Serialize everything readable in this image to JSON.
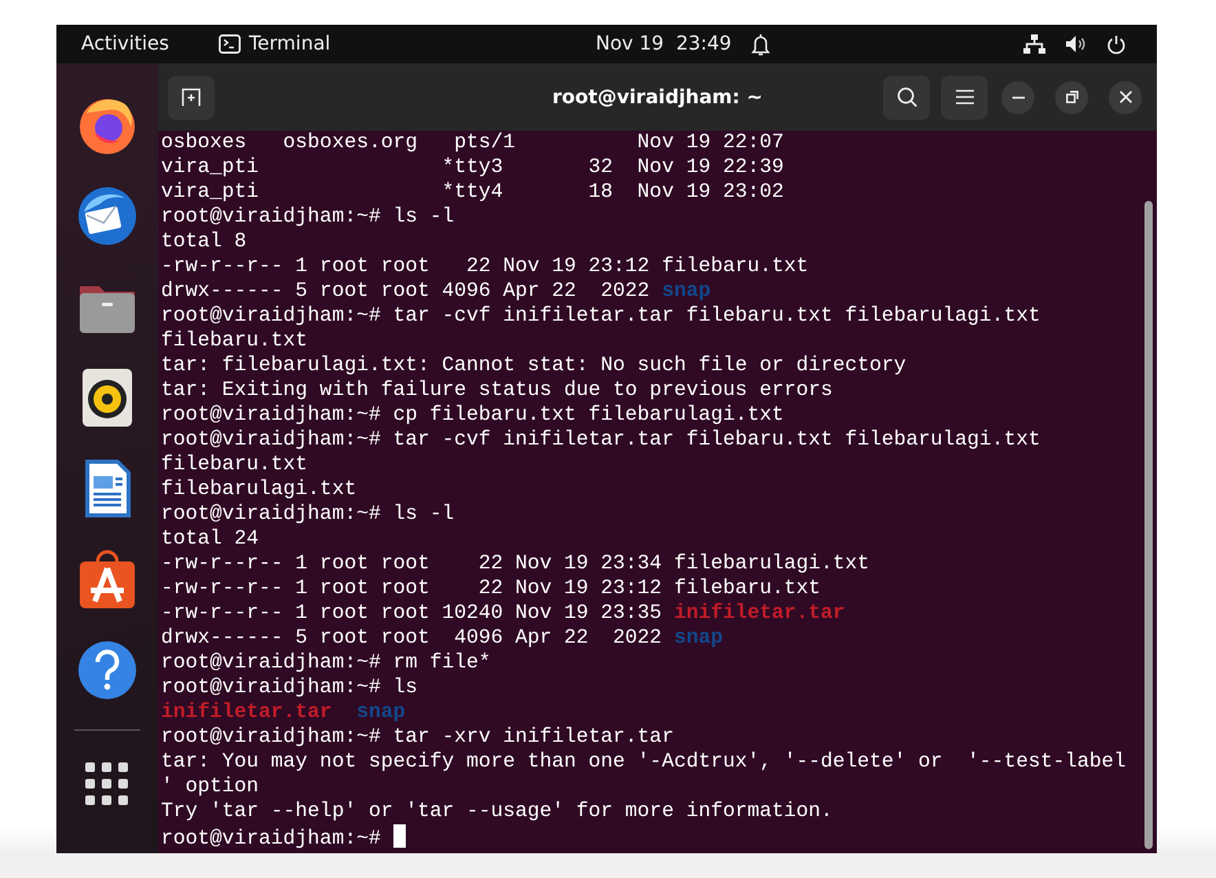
{
  "top_bar": {
    "activities": "Activities",
    "app_name": "Terminal",
    "clock": "Nov 19  23:49"
  },
  "dock": {
    "items": [
      {
        "kind": "browser"
      },
      {
        "kind": "mail"
      },
      {
        "kind": "files"
      },
      {
        "kind": "music"
      },
      {
        "kind": "writer"
      },
      {
        "kind": "software"
      },
      {
        "kind": "help"
      }
    ]
  },
  "terminal": {
    "title": "root@viraidjham: ~",
    "cursor": true,
    "lines": [
      [
        {
          "kind": "text",
          "text": "osboxes   osboxes.org   pts/1          Nov 19 22:07"
        }
      ],
      [
        {
          "kind": "text",
          "text": "vira_pti               *tty3       32  Nov 19 22:39"
        }
      ],
      [
        {
          "kind": "text",
          "text": "vira_pti               *tty4       18  Nov 19 23:02"
        }
      ],
      [
        {
          "kind": "text",
          "text": "root@viraidjham:~# ls -l"
        }
      ],
      [
        {
          "kind": "text",
          "text": "total 8"
        }
      ],
      [
        {
          "kind": "text",
          "text": "-rw-r--r-- 1 root root   22 Nov 19 23:12 filebaru.txt"
        }
      ],
      [
        {
          "kind": "text",
          "text": "drwx------ 5 root root 4096 Apr 22  2022 "
        },
        {
          "kind": "directory",
          "text": "snap"
        }
      ],
      [
        {
          "kind": "text",
          "text": "root@viraidjham:~# tar -cvf inifiletar.tar filebaru.txt filebarulagi.txt"
        }
      ],
      [
        {
          "kind": "text",
          "text": "filebaru.txt"
        }
      ],
      [
        {
          "kind": "text",
          "text": "tar: filebarulagi.txt: Cannot stat: No such file or directory"
        }
      ],
      [
        {
          "kind": "text",
          "text": "tar: Exiting with failure status due to previous errors"
        }
      ],
      [
        {
          "kind": "text",
          "text": "root@viraidjham:~# cp filebaru.txt filebarulagi.txt"
        }
      ],
      [
        {
          "kind": "text",
          "text": "root@viraidjham:~# tar -cvf inifiletar.tar filebaru.txt filebarulagi.txt"
        }
      ],
      [
        {
          "kind": "text",
          "text": "filebaru.txt"
        }
      ],
      [
        {
          "kind": "text",
          "text": "filebarulagi.txt"
        }
      ],
      [
        {
          "kind": "text",
          "text": "root@viraidjham:~# ls -l"
        }
      ],
      [
        {
          "kind": "text",
          "text": "total 24"
        }
      ],
      [
        {
          "kind": "text",
          "text": "-rw-r--r-- 1 root root    22 Nov 19 23:34 filebarulagi.txt"
        }
      ],
      [
        {
          "kind": "text",
          "text": "-rw-r--r-- 1 root root    22 Nov 19 23:12 filebaru.txt"
        }
      ],
      [
        {
          "kind": "text",
          "text": "-rw-r--r-- 1 root root 10240 Nov 19 23:35 "
        },
        {
          "kind": "archive",
          "text": "inifiletar.tar"
        }
      ],
      [
        {
          "kind": "text",
          "text": "drwx------ 5 root root  4096 Apr 22  2022 "
        },
        {
          "kind": "directory",
          "text": "snap"
        }
      ],
      [
        {
          "kind": "text",
          "text": "root@viraidjham:~# rm file*"
        }
      ],
      [
        {
          "kind": "text",
          "text": "root@viraidjham:~# ls"
        }
      ],
      [
        {
          "kind": "archive",
          "text": "inifiletar.tar"
        },
        {
          "kind": "directory",
          "text": "  snap"
        }
      ],
      [
        {
          "kind": "text",
          "text": "root@viraidjham:~# tar -xrv inifiletar.tar"
        }
      ],
      [
        {
          "kind": "text",
          "text": "tar: You may not specify more than one '-Acdtrux', '--delete' or  '--test-label"
        }
      ],
      [
        {
          "kind": "text",
          "text": "' option"
        }
      ],
      [
        {
          "kind": "text",
          "text": "Try 'tar --help' or 'tar --usage' for more information."
        }
      ],
      [
        {
          "kind": "text",
          "text": "root@viraidjham:~# "
        }
      ]
    ]
  }
}
